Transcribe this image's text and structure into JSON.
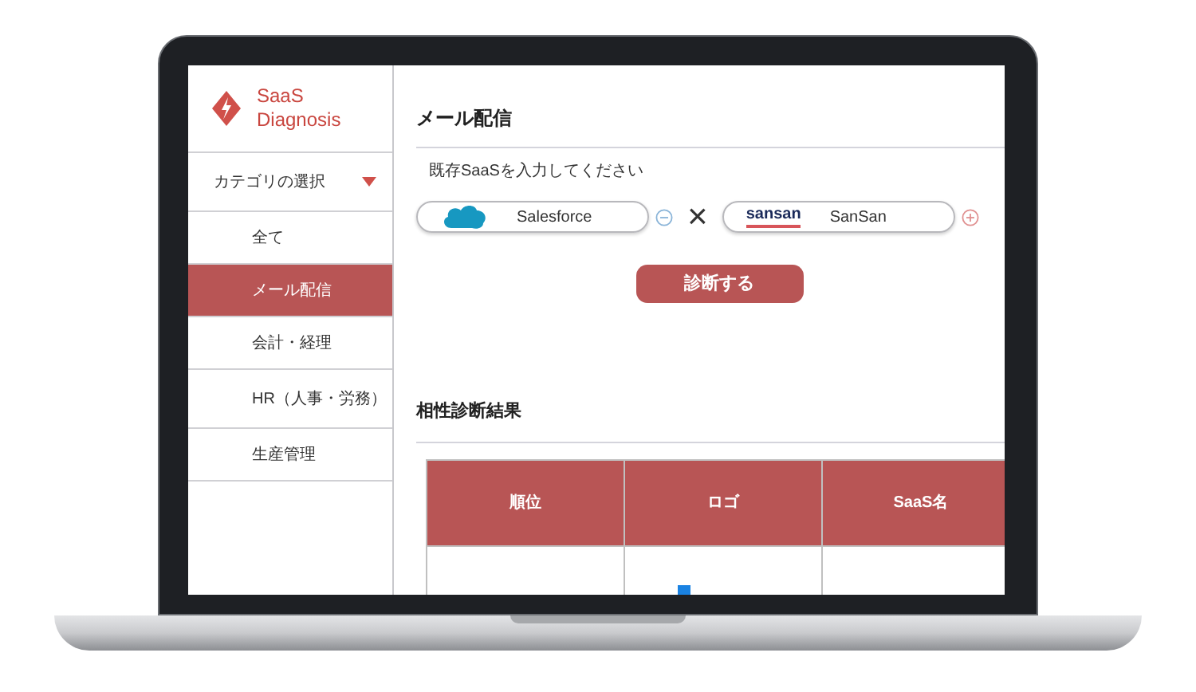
{
  "sidebar": {
    "logo": {
      "text": "SaaS Diagnosis"
    },
    "category": {
      "label": "カテゴリの選択",
      "expanded": true
    },
    "items": [
      {
        "label": "全て",
        "selected": false
      },
      {
        "label": "メール配信",
        "selected": true
      },
      {
        "label": "会計・経理",
        "selected": false
      },
      {
        "label": "HR（人事・労務）",
        "selected": false
      },
      {
        "label": "生産管理",
        "selected": false
      }
    ]
  },
  "main": {
    "title": "メール配信",
    "prompt": "既存SaaSを入力してください",
    "inputs": [
      {
        "value": "Salesforce",
        "logo": {
          "kind": "cloud"
        },
        "action": {
          "kind": "remove"
        }
      },
      {
        "value": "SanSan",
        "logo": {
          "kind": "wordmark",
          "text": "sansan"
        },
        "action": {
          "kind": "add"
        }
      }
    ],
    "combine_symbol": "×",
    "button": "診断する",
    "results_title": "相性診断結果",
    "table": {
      "columns": [
        "順位",
        "ロゴ",
        "SaaS名"
      ]
    }
  }
}
